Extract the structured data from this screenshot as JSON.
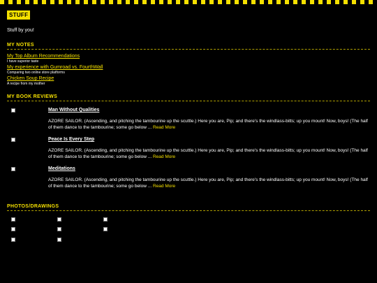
{
  "brand": {
    "logo": "STUFF",
    "tagline": "Stuff by you!"
  },
  "notes": {
    "heading": "MY NOTES",
    "items": [
      {
        "title": "My Top Album Recommendations",
        "desc": "I have superior taste"
      },
      {
        "title": "My experience with Gumroad vs. FourthWall",
        "desc": "Comparing two online store platforms"
      },
      {
        "title": "Chicken Soup Recipe",
        "desc": "A recipe from my mother"
      }
    ]
  },
  "reviews": {
    "heading": "MY BOOK REVIEWS",
    "read_more": "Read More",
    "items": [
      {
        "title": "Man Without Qualities",
        "excerpt": "AZORE SAILOR. (Ascending, and pitching the tambourine up the scuttle.) Here you are, Pip; and there's the windlass-bitts; up you mount! Now, boys! (The half of them dance to the tambourine; some go below ..."
      },
      {
        "title": "Peace Is Every Step",
        "excerpt": "AZORE SAILOR. (Ascending, and pitching the tambourine up the scuttle.) Here you are, Pip; and there's the windlass-bitts; up you mount! Now, boys! (The half of them dance to the tambourine; some go below ..."
      },
      {
        "title": "Meditations",
        "excerpt": "AZORE SAILOR. (Ascending, and pitching the tambourine up the scuttle.) Here you are, Pip; and there's the windlass-bitts; up you mount! Now, boys! (The half of them dance to the tambourine; some go below ..."
      }
    ]
  },
  "photos": {
    "heading": "PHOTOS/DRAWINGS"
  },
  "colors": {
    "accent": "#f5e000",
    "background": "#000000",
    "text": "#ffffff"
  }
}
